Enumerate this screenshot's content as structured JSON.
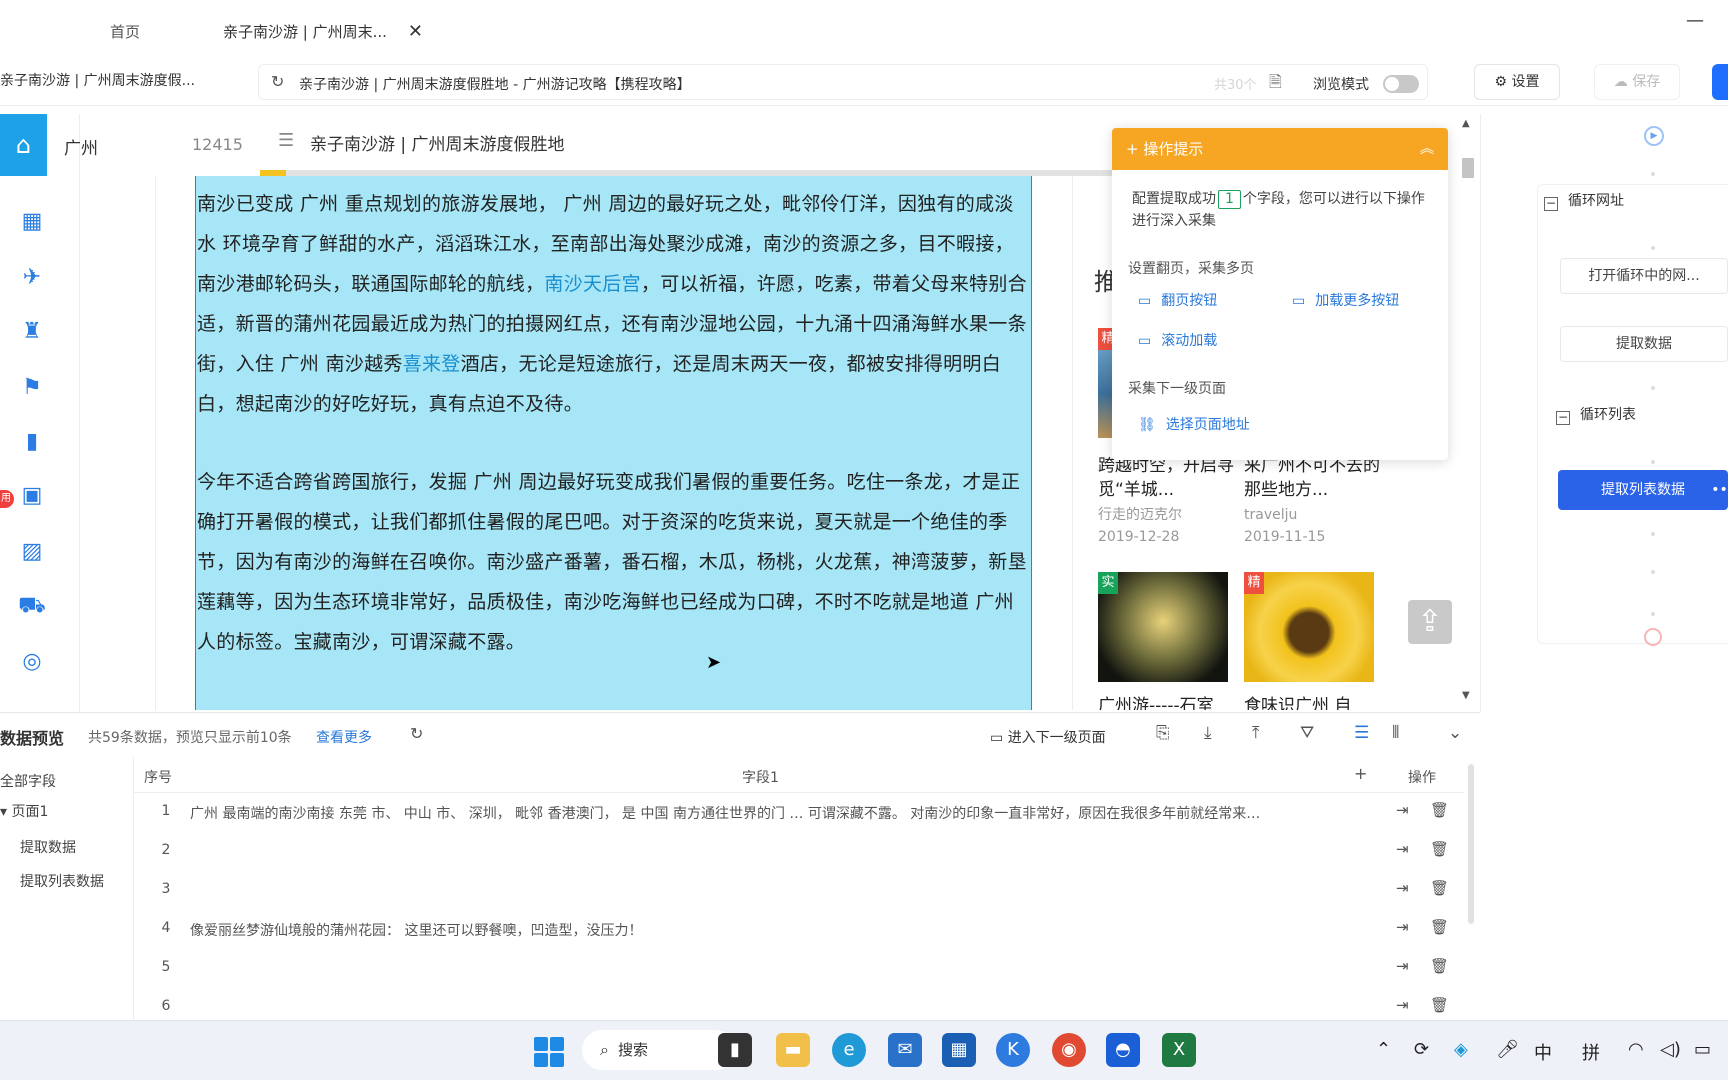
{
  "tabs": {
    "home": "首页",
    "active": "亲子南沙游 | 广州周末...",
    "close_glyph": "✕",
    "minimize_glyph": "—"
  },
  "address": {
    "page_label": "亲子南沙游 | 广州周末游度假...",
    "url": "亲子南沙游 | 广州周末游度假胜地 - 广州游记攻略【携程攻略】",
    "count_hint": "共30个",
    "browse_mode_label": "浏览模式",
    "browse_mode_on": false,
    "settings_label": "设置",
    "save_label": "保存"
  },
  "site": {
    "city": "广州",
    "city_number": "12415",
    "title": "亲子南沙游 | 广州周末游度假胜地",
    "read_progress_percent": 3
  },
  "article": {
    "p1_a": "南沙已变成 广州 重点规划的旅游发展地， 广州 周边的最好玩之处，毗邻伶仃洋，因独有的咸淡水 环境孕育了鲜甜的水产，滔滔珠江水，至南部出海处聚沙成滩，南沙的资源之多，目不暇接，南沙港邮轮码头，联通国际邮轮的航线，",
    "p1_link1": "南沙天后宫",
    "p1_b": "，可以祈福，许愿，吃素，带着父母来特别合适，新晋的蒲州花园最近成为热门的拍摄网红点，还有南沙湿地公园，十九涌十四涌海鲜水果一条街，入住 广州 南沙越秀",
    "p1_link2": "喜来登",
    "p1_c": "酒店，无论是短途旅行，还是周末两天一夜，都被安排得明明白白，想起南沙的好吃好玩，真有点迫不及待。",
    "p2": "今年不适合跨省跨国旅行，发掘 广州 周边最好玩变成我们暑假的重要任务。吃住一条龙，才是正确打开暑假的模式，让我们都抓住暑假的尾巴吧。对于资深的吃货来说，夏天就是一个绝佳的季节，因为有南沙的海鲜在召唤你。南沙盛产番薯，番石榴，木瓜，杨桃，火龙蕉，神湾菠萝，新垦莲藕等，因为生态环境非常好，品质极佳，南沙吃海鲜也已经成为口碑，不时不吃就是地道 广州 人的标签。宝藏南沙，可谓深藏不露。"
  },
  "recommend": {
    "heading": "推",
    "cards": [
      {
        "tag": "精",
        "title": "跨越时空，开启寻觅“羊城...",
        "author": "行走的迈克尔",
        "date": "2019-12-28"
      },
      {
        "tag": "",
        "title": "来广州不可不去的那些地方...",
        "author": "travelju",
        "date": "2019-11-15"
      },
      {
        "tag": "实",
        "title": "广州游-----石室",
        "author": "",
        "date": ""
      },
      {
        "tag": "精",
        "title": "食味识广州 自",
        "author": "",
        "date": ""
      }
    ]
  },
  "popup": {
    "title": "操作提示",
    "msg_before": "配置提取成功",
    "field_count": "1",
    "msg_after": "个字段，您可以进行以下操作进行深入采集",
    "section_paging": "设置翻页，采集多页",
    "link_page_btn": "翻页按钮",
    "link_load_more": "加载更多按钮",
    "link_scroll": "滚动加载",
    "section_next": "采集下一级页面",
    "link_select_url": "选择页面地址"
  },
  "workflow": {
    "group_loop_url": "循环网址",
    "node_open_loop": "打开循环中的网...",
    "node_extract": "提取数据",
    "group_loop_list": "循环列表",
    "node_extract_list": "提取列表数据"
  },
  "preview": {
    "title": "数据预览",
    "summary": "共59条数据，预览只显示前10条",
    "more": "查看更多",
    "next_level": "进入下一级页面",
    "tree_all": "全部字段",
    "tree_page": "页面1",
    "tree_extract": "提取数据",
    "tree_extract_list": "提取列表数据",
    "col_no": "序号",
    "col_field": "字段1",
    "col_add": "+",
    "col_ops": "操作",
    "rows": [
      {
        "no": "1",
        "text": "广州 最南端的南沙南接 东莞 市、 中山 市、 深圳， 毗邻 香港澳门， 是 中国 南方通往世界的门 … 可谓深藏不露。 对南沙的印象一直非常好，原因在我很多年前就经常来…"
      },
      {
        "no": "2",
        "text": ""
      },
      {
        "no": "3",
        "text": ""
      },
      {
        "no": "4",
        "text": "像爱丽丝梦游仙境般的蒲州花园： 这里还可以野餐噢，凹造型，没压力！"
      },
      {
        "no": "5",
        "text": ""
      },
      {
        "no": "6",
        "text": ""
      }
    ]
  },
  "taskbar": {
    "search": "搜索",
    "ime_zh": "中",
    "ime_pinyin": "拼"
  },
  "colors": {
    "accent_blue": "#2b63e8",
    "highlight": "#a6e6f6",
    "popup_orange": "#f6a623",
    "link_blue": "#2a78d8"
  }
}
